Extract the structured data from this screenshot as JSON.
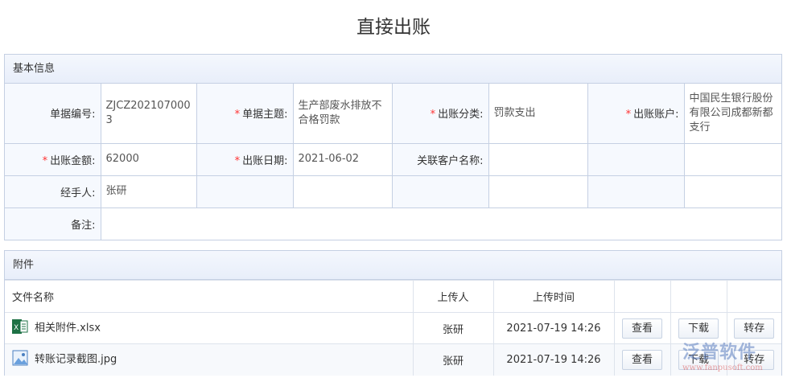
{
  "title": "直接出账",
  "basic": {
    "header": "基本信息",
    "doc_no_label": "单据编号:",
    "doc_no": "ZJCZ2021070003",
    "subject_label": "单据主题:",
    "subject": "生产部废水排放不合格罚款",
    "category_label": "出账分类:",
    "category": "罚款支出",
    "account_label": "出账账户:",
    "account": "中国民生银行股份有限公司成都新都支行",
    "amount_label": "出账金额:",
    "amount": "62000",
    "date_label": "出账日期:",
    "date": "2021-06-02",
    "customer_label": "关联客户名称:",
    "customer": "",
    "handler_label": "经手人:",
    "handler": "张研",
    "remark_label": "备注:",
    "remark": "",
    "required_mark": "*"
  },
  "attachments": {
    "header": "附件",
    "columns": [
      "文件名称",
      "上传人",
      "上传时间"
    ],
    "rows": [
      {
        "name": "相关附件.xlsx",
        "icon": "excel-file-icon",
        "uploader": "张研",
        "time": "2021-07-19 14:26",
        "view": "查看",
        "download": "下载",
        "transfer": "转存"
      },
      {
        "name": "转账记录截图.jpg",
        "icon": "image-file-icon",
        "uploader": "张研",
        "time": "2021-07-19 14:26",
        "view": "查看",
        "download": "下载",
        "transfer": "转存"
      }
    ]
  },
  "watermark": {
    "brand": "泛普软件",
    "url": "www.fanpusoft.com"
  }
}
